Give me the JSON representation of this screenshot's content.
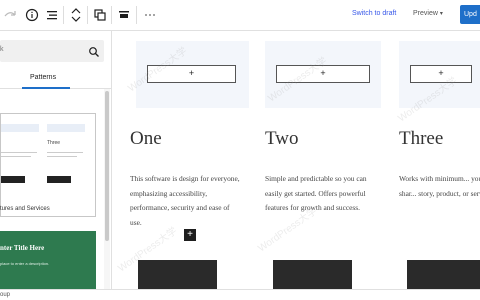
{
  "toolbar": {
    "icons": [
      "redo-icon",
      "info-icon",
      "list-view-icon",
      "block-mover-icon",
      "group-icon",
      "align-icon",
      "more-options-icon"
    ],
    "switch_draft": "Switch to draft",
    "preview": "Preview",
    "update": "Upd"
  },
  "sidebar": {
    "search_placeholder": "k",
    "active_tab": "Patterns",
    "pattern1": {
      "columns": [
        "",
        "Three"
      ],
      "caption": "tures and Services"
    },
    "pattern2": {
      "title": "nter Title Here",
      "subtitle": "place to enter a description."
    }
  },
  "canvas": {
    "columns": [
      {
        "heading": "One",
        "body": "This software is design for everyone, emphasizing accessibility, performance, security and ease of use."
      },
      {
        "heading": "Two",
        "body": "Simple and predictable so you can easily get started. Offers powerful features for growth and success."
      },
      {
        "heading": "Three",
        "body": "Works with minimum... you can focus on shar... story, product, or serv... freely."
      }
    ],
    "image_placeholder": "+",
    "add_block": "+",
    "watermark": "WordPress大学"
  },
  "footer": {
    "breadcrumb": "oup"
  }
}
